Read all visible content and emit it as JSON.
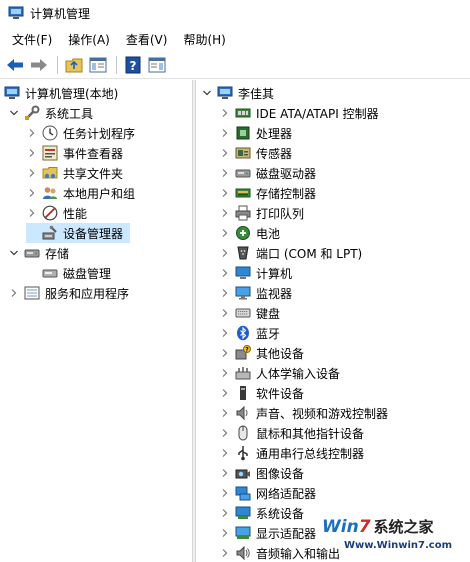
{
  "window": {
    "title": "计算机管理"
  },
  "menu": [
    "文件(F)",
    "操作(A)",
    "查看(V)",
    "帮助(H)"
  ],
  "left_tree": {
    "root": "计算机管理(本地)",
    "system_tools": {
      "label": "系统工具",
      "children": [
        "任务计划程序",
        "事件查看器",
        "共享文件夹",
        "本地用户和组",
        "性能",
        "设备管理器"
      ]
    },
    "storage": {
      "label": "存储",
      "children": [
        "磁盘管理"
      ]
    },
    "services": "服务和应用程序",
    "selected": "设备管理器"
  },
  "right_tree": {
    "root": "李佳其",
    "categories": [
      {
        "label": "IDE ATA/ATAPI 控制器",
        "icon": "ide-controller-icon"
      },
      {
        "label": "处理器",
        "icon": "processor-icon"
      },
      {
        "label": "传感器",
        "icon": "sensor-icon"
      },
      {
        "label": "磁盘驱动器",
        "icon": "disk-drive-icon"
      },
      {
        "label": "存储控制器",
        "icon": "storage-controller-icon"
      },
      {
        "label": "打印队列",
        "icon": "printer-icon"
      },
      {
        "label": "电池",
        "icon": "battery-icon"
      },
      {
        "label": "端口 (COM 和 LPT)",
        "icon": "port-icon"
      },
      {
        "label": "计算机",
        "icon": "computer-icon"
      },
      {
        "label": "监视器",
        "icon": "monitor-icon"
      },
      {
        "label": "键盘",
        "icon": "keyboard-icon"
      },
      {
        "label": "蓝牙",
        "icon": "bluetooth-icon"
      },
      {
        "label": "其他设备",
        "icon": "other-devices-icon"
      },
      {
        "label": "人体学输入设备",
        "icon": "hid-icon"
      },
      {
        "label": "软件设备",
        "icon": "software-device-icon"
      },
      {
        "label": "声音、视频和游戏控制器",
        "icon": "sound-icon"
      },
      {
        "label": "鼠标和其他指针设备",
        "icon": "mouse-icon"
      },
      {
        "label": "通用串行总线控制器",
        "icon": "usb-icon"
      },
      {
        "label": "图像设备",
        "icon": "camera-icon"
      },
      {
        "label": "网络适配器",
        "icon": "network-adapter-icon"
      },
      {
        "label": "系统设备",
        "icon": "system-device-icon"
      },
      {
        "label": "显示适配器",
        "icon": "display-adapter-icon"
      },
      {
        "label": "音频输入和输出",
        "icon": "audio-io-icon"
      }
    ]
  },
  "watermark": {
    "brand_a": "Win",
    "brand_b": "7",
    "brand_cn": "系统之家",
    "url": "Www.Winwin7.com"
  },
  "colors": {
    "selection": "#cce8ff",
    "toolbar_blue": "#1e5fb4",
    "brand_blue": "#1b6fc0",
    "brand_red": "#d62828"
  }
}
